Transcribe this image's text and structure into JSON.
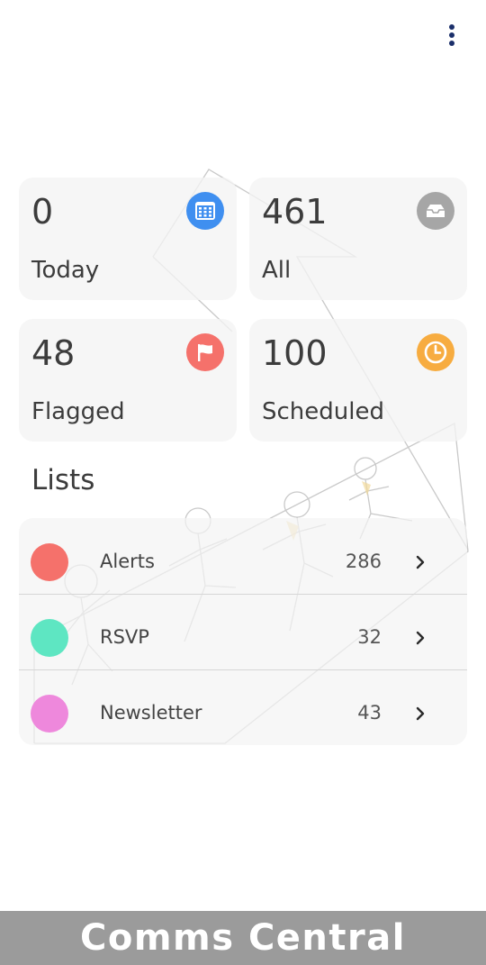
{
  "app": {
    "footer_title": "Comms Central"
  },
  "header": {
    "more_icon": "more-vertical-icon"
  },
  "summary_cards": [
    {
      "count": "0",
      "label": "Today",
      "icon": "calendar-icon",
      "icon_color": "#3f8ff0"
    },
    {
      "count": "461",
      "label": "All",
      "icon": "inbox-tray-icon",
      "icon_color": "#a6a6a6"
    },
    {
      "count": "48",
      "label": "Flagged",
      "icon": "flag-icon",
      "icon_color": "#f5716b"
    },
    {
      "count": "100",
      "label": "Scheduled",
      "icon": "clock-icon",
      "icon_color": "#f7ac40"
    }
  ],
  "lists": {
    "title": "Lists",
    "items": [
      {
        "name": "Alerts",
        "count": "286",
        "color": "#f5716b",
        "chevron": "chevron-right-icon"
      },
      {
        "name": "RSVP",
        "count": "32",
        "color": "#5ee6c2",
        "chevron": "chevron-right-icon"
      },
      {
        "name": "Newsletter",
        "count": "43",
        "color": "#ee88dc",
        "chevron": "chevron-right-icon"
      }
    ]
  },
  "colors": {
    "footer_background": "#9b9b9b",
    "more_icon": "#1b2f6a"
  }
}
